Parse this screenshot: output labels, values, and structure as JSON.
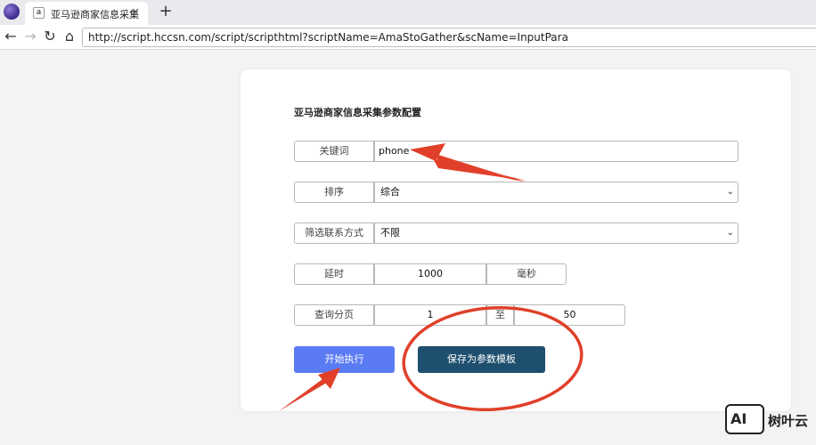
{
  "browser": {
    "tab_title": "亚马逊商家信息采集",
    "tab_favicon": "a",
    "tab_close": "×",
    "new_tab": "+",
    "url": "http://script.hccsn.com/script/scripthtml?scriptName=AmaStoGather&scName=InputPara",
    "icons": [
      "back-arrow-icon",
      "forward-arrow-icon",
      "reload-icon",
      "home-icon"
    ]
  },
  "form": {
    "title": "亚马逊商家信息采集参数配置",
    "keyword": {
      "label": "关键词",
      "value": "phone"
    },
    "sort": {
      "label": "排序",
      "selected": "综合"
    },
    "contact_filter": {
      "label": "筛选联系方式",
      "selected": "不限"
    },
    "delay": {
      "label": "延时",
      "value": "1000",
      "unit": "毫秒"
    },
    "pages": {
      "label": "查询分页",
      "from": "1",
      "sep": "至",
      "to": "50"
    },
    "start_button": "开始执行",
    "save_button": "保存为参数模板"
  },
  "watermark": {
    "logo": "AI",
    "text": "树叶云"
  },
  "colors": {
    "start_button": "#5b7bf4",
    "save_button": "#1e4f6e",
    "annotation": "#e0402a"
  }
}
